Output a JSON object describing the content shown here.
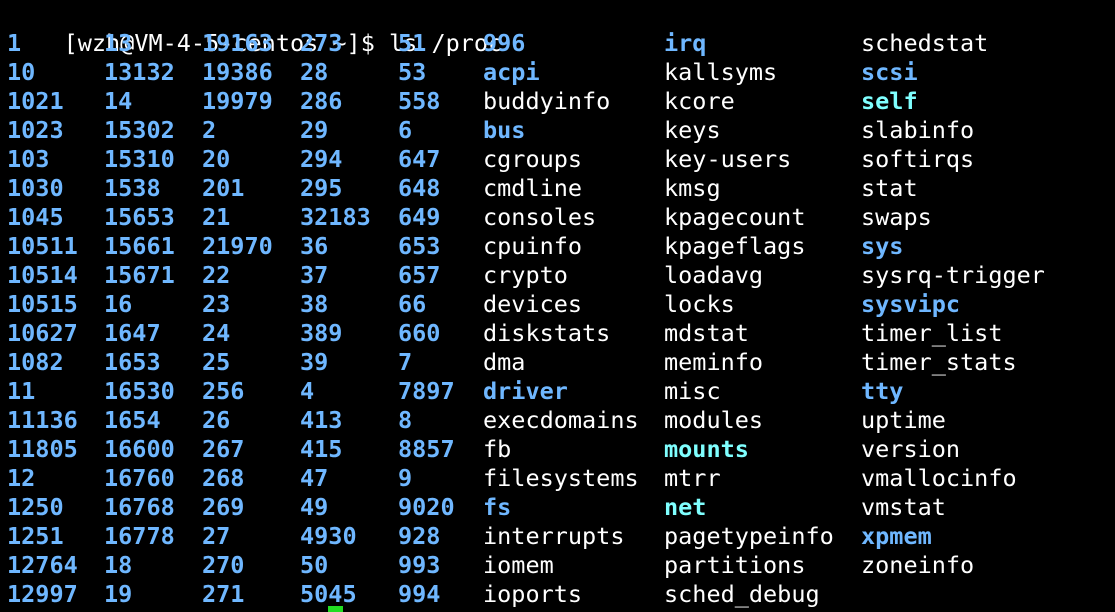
{
  "terminal": {
    "prompt": "[wzh@VM-4-5-centos ~]$ ls /proc",
    "colors": {
      "background": "#000000",
      "text": "#ffffff",
      "directory": "#6fb7ff",
      "symlink": "#7fffff",
      "cursor": "#22dd22"
    },
    "listing": [
      [
        "1",
        "13",
        "19163",
        "273",
        "51",
        "996",
        "irq",
        "schedstat"
      ],
      [
        "10",
        "13132",
        "19386",
        "28",
        "53",
        "acpi",
        "kallsyms",
        "scsi"
      ],
      [
        "1021",
        "14",
        "19979",
        "286",
        "558",
        "buddyinfo",
        "kcore",
        "self"
      ],
      [
        "1023",
        "15302",
        "2",
        "29",
        "6",
        "bus",
        "keys",
        "slabinfo"
      ],
      [
        "103",
        "15310",
        "20",
        "294",
        "647",
        "cgroups",
        "key-users",
        "softirqs"
      ],
      [
        "1030",
        "1538",
        "201",
        "295",
        "648",
        "cmdline",
        "kmsg",
        "stat"
      ],
      [
        "1045",
        "15653",
        "21",
        "32183",
        "649",
        "consoles",
        "kpagecount",
        "swaps"
      ],
      [
        "10511",
        "15661",
        "21970",
        "36",
        "653",
        "cpuinfo",
        "kpageflags",
        "sys"
      ],
      [
        "10514",
        "15671",
        "22",
        "37",
        "657",
        "crypto",
        "loadavg",
        "sysrq-trigger"
      ],
      [
        "10515",
        "16",
        "23",
        "38",
        "66",
        "devices",
        "locks",
        "sysvipc"
      ],
      [
        "10627",
        "1647",
        "24",
        "389",
        "660",
        "diskstats",
        "mdstat",
        "timer_list"
      ],
      [
        "1082",
        "1653",
        "25",
        "39",
        "7",
        "dma",
        "meminfo",
        "timer_stats"
      ],
      [
        "11",
        "16530",
        "256",
        "4",
        "7897",
        "driver",
        "misc",
        "tty"
      ],
      [
        "11136",
        "1654",
        "26",
        "413",
        "8",
        "execdomains",
        "modules",
        "uptime"
      ],
      [
        "11805",
        "16600",
        "267",
        "415",
        "8857",
        "fb",
        "mounts",
        "version"
      ],
      [
        "12",
        "16760",
        "268",
        "47",
        "9",
        "filesystems",
        "mtrr",
        "vmallocinfo"
      ],
      [
        "1250",
        "16768",
        "269",
        "49",
        "9020",
        "fs",
        "net",
        "vmstat"
      ],
      [
        "1251",
        "16778",
        "27",
        "4930",
        "928",
        "interrupts",
        "pagetypeinfo",
        "xpmem"
      ],
      [
        "12764",
        "18",
        "270",
        "50",
        "993",
        "iomem",
        "partitions",
        "zoneinfo"
      ],
      [
        "12997",
        "19",
        "271",
        "5045",
        "994",
        "ioports",
        "sched_debug",
        ""
      ]
    ],
    "directories": [
      "996",
      "irq",
      "acpi",
      "scsi",
      "bus",
      "sys",
      "sysvipc",
      "driver",
      "tty",
      "fs",
      "xpmem"
    ],
    "symlinks": [
      "self",
      "mounts",
      "net"
    ]
  }
}
